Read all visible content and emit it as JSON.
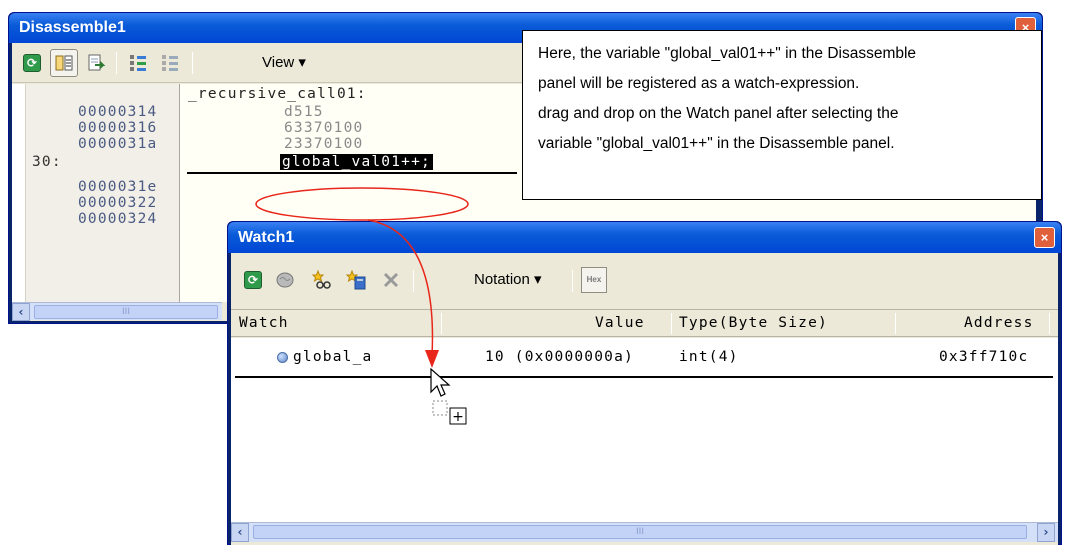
{
  "disassemble": {
    "title": "Disassemble1",
    "close": "×",
    "toolbar": {
      "view_label": "View ▾"
    },
    "label_line": "_recursive_call01:",
    "rows": [
      {
        "addr": "00000314",
        "code": "d515"
      },
      {
        "addr": "00000316",
        "code": "63370100"
      },
      {
        "addr": "0000031a",
        "code": "23370100"
      }
    ],
    "line_num": "30:",
    "selected_expr": "global_val01++",
    "selected_tail": ";",
    "rows_after": [
      {
        "addr": "0000031e"
      },
      {
        "addr": "00000322"
      },
      {
        "addr": "00000324"
      }
    ],
    "scroll_thumb": "III"
  },
  "callout": {
    "lines": [
      "Here, the variable \"global_val01++\" in the Disassemble",
      "panel will be registered as a watch-expression.",
      "drag and drop on the Watch panel after selecting the",
      "variable \"global_val01++\" in the Disassemble panel."
    ]
  },
  "watch": {
    "title": "Watch1",
    "close": "×",
    "toolbar": {
      "notation_label": "Notation ▾",
      "hex_label": "Hex"
    },
    "columns": {
      "watch": "Watch",
      "value": "Value",
      "type": "Type(Byte Size)",
      "address": "Address"
    },
    "rows": [
      {
        "name": "global_a",
        "value": "10 (0x0000000a)",
        "type": "int(4)",
        "address": "0x3ff710c"
      }
    ],
    "scroll_thumb": "III",
    "drop_badge": "+"
  },
  "colors": {
    "title_bar": "#0a5bd8",
    "accent_red": "#e8261a",
    "selection": "#000000"
  }
}
